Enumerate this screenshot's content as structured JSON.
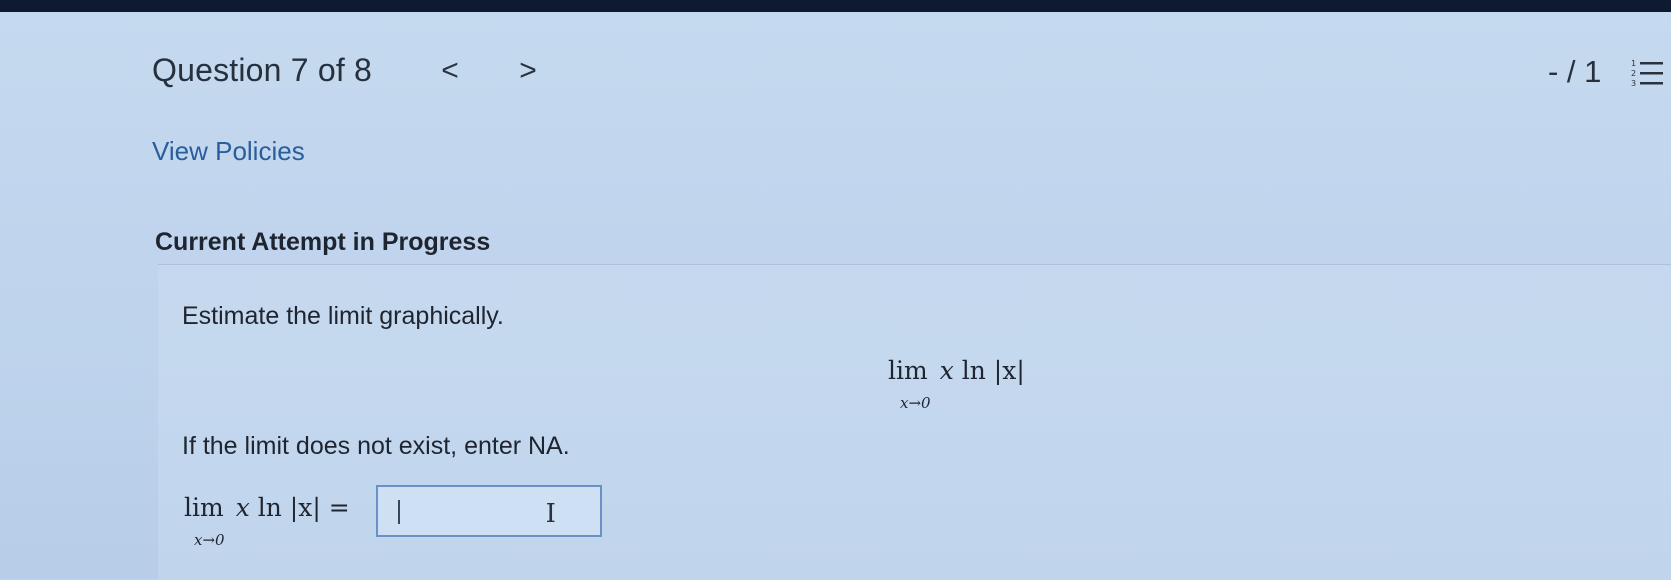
{
  "header": {
    "question_label": "Question 7 of 8",
    "prev_icon": "chevron-left-icon",
    "next_icon": "chevron-right-icon",
    "prev_glyph": "<",
    "next_glyph": ">",
    "score": "- / 1",
    "list_icon": "numbered-list-icon"
  },
  "links": {
    "view_policies": "View Policies"
  },
  "attempt": {
    "heading": "Current Attempt in Progress"
  },
  "question": {
    "instruction": "Estimate the limit graphically.",
    "limit_word": "lim",
    "limit_sub": "x→0",
    "limit_expr_x": "x",
    "limit_expr_rest": " ln |x|",
    "na_instruction": "If the limit does not exist, enter NA.",
    "answer_equals": " ="
  },
  "answer_input": {
    "value": ""
  },
  "colors": {
    "link": "#2a5d9c",
    "input_border": "#6b91c4",
    "bezel": "#0d1a30"
  }
}
